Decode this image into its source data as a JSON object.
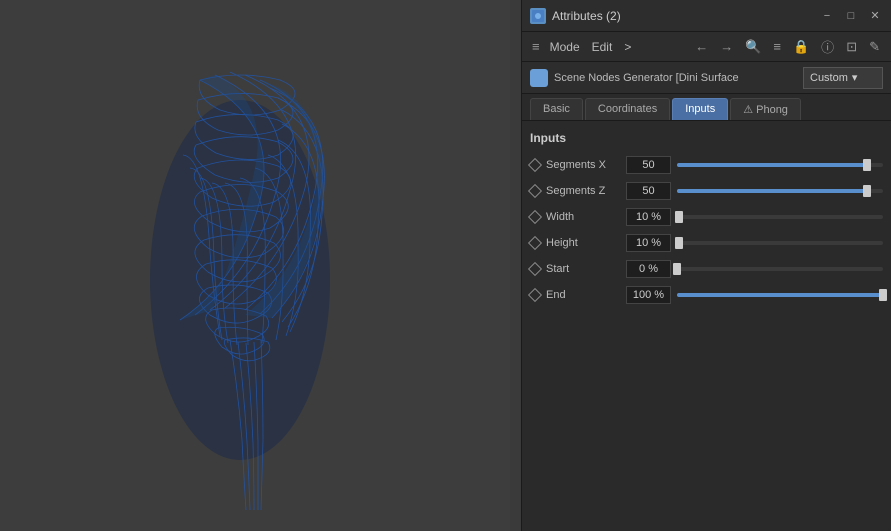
{
  "title_bar": {
    "title": "Attributes (2)",
    "icon_color": "#5a8fc4",
    "minimize_label": "−",
    "maximize_label": "□",
    "close_label": "✕"
  },
  "toolbar": {
    "hamburger": "≡",
    "mode_label": "Mode",
    "edit_label": "Edit",
    "arrow_label": ">",
    "back_arrow": "←",
    "forward_arrow": "→",
    "search_icon": "🔍",
    "list_icon": "≡",
    "lock_icon": "🔒",
    "external_icon": "⊡",
    "edit2_icon": "✎"
  },
  "node_bar": {
    "node_name": "Scene Nodes Generator [Dini Surface",
    "preset_label": "Custom",
    "dropdown_arrow": "▾"
  },
  "tabs": [
    {
      "id": "basic",
      "label": "Basic",
      "active": false
    },
    {
      "id": "coordinates",
      "label": "Coordinates",
      "active": false
    },
    {
      "id": "inputs",
      "label": "Inputs",
      "active": true
    },
    {
      "id": "phong",
      "label": "⚠ Phong",
      "active": false
    }
  ],
  "inputs_section": {
    "title": "Inputs",
    "params": [
      {
        "id": "segments_x",
        "name": "Segments X",
        "value": "50",
        "fill_pct": 92,
        "handle_pct": 92
      },
      {
        "id": "segments_z",
        "name": "Segments Z",
        "value": "50",
        "fill_pct": 92,
        "handle_pct": 92
      },
      {
        "id": "width",
        "name": "Width",
        "value": "10 %",
        "fill_pct": 1,
        "handle_pct": 1
      },
      {
        "id": "height",
        "name": "Height",
        "value": "10 %",
        "fill_pct": 1,
        "handle_pct": 1
      },
      {
        "id": "start",
        "name": "Start",
        "value": "0 %",
        "fill_pct": 0,
        "handle_pct": 0
      },
      {
        "id": "end",
        "name": "End",
        "value": "100 %",
        "fill_pct": 100,
        "handle_pct": 100
      }
    ]
  }
}
